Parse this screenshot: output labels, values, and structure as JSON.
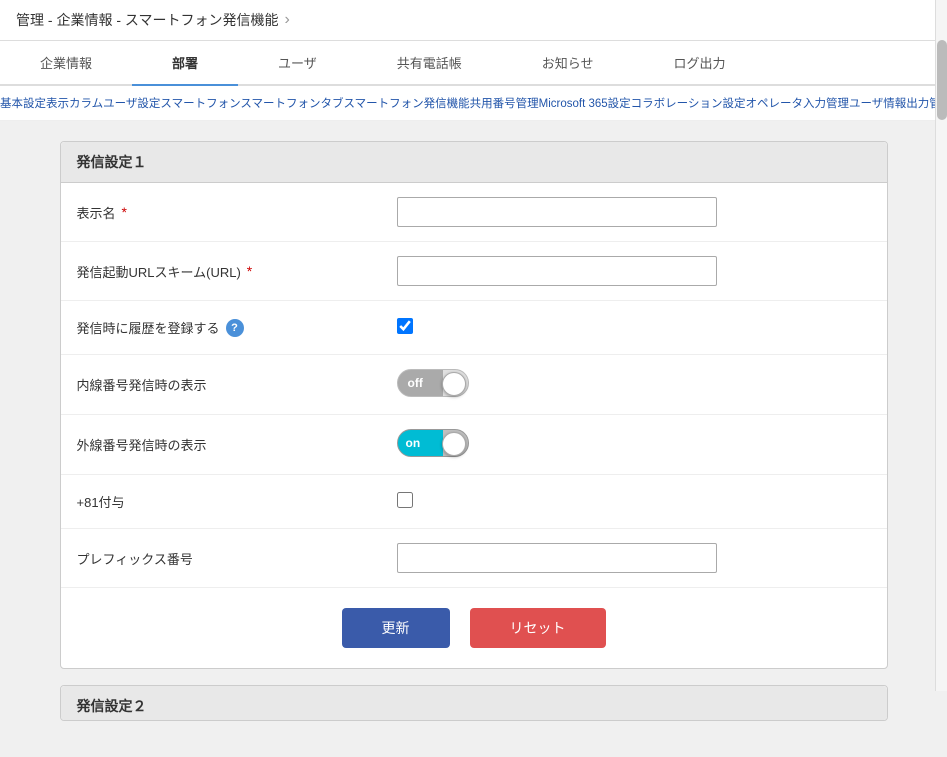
{
  "header": {
    "breadcrumb": "管理 - 企業情報 - スマートフォン発信機能",
    "arrow": "›"
  },
  "nav_tabs": [
    {
      "id": "company",
      "label": "企業情報",
      "active": false
    },
    {
      "id": "department",
      "label": "部署",
      "active": true
    },
    {
      "id": "user",
      "label": "ユーザ",
      "active": false
    },
    {
      "id": "shared_phonebook",
      "label": "共有電話帳",
      "active": false
    },
    {
      "id": "notice",
      "label": "お知らせ",
      "active": false
    },
    {
      "id": "log_output",
      "label": "ログ出力",
      "active": false
    }
  ],
  "sub_nav": "基本設定表示カラムユーザ設定スマートフォンスマートフォンタブスマートフォン発信機能共用番号管理Microsoft 365設定コラボレーション設定オペレータ入力管理ユーザ情報出力管理エクス",
  "section1": {
    "title": "発信設定１",
    "fields": [
      {
        "id": "display_name",
        "label": "表示名",
        "required": true,
        "type": "text",
        "value": ""
      },
      {
        "id": "url_scheme",
        "label": "発信起動URLスキーム(URL)",
        "required": true,
        "type": "text",
        "value": ""
      },
      {
        "id": "register_history",
        "label": "発信時に履歴を登録する",
        "required": false,
        "type": "checkbox",
        "checked": true,
        "help": true
      },
      {
        "id": "extension_display",
        "label": "内線番号発信時の表示",
        "required": false,
        "type": "toggle",
        "value": "off"
      },
      {
        "id": "external_display",
        "label": "外線番号発信時の表示",
        "required": false,
        "type": "toggle",
        "value": "on"
      },
      {
        "id": "plus81",
        "label": "+81付与",
        "required": false,
        "type": "checkbox",
        "checked": false
      },
      {
        "id": "prefix",
        "label": "プレフィックス番号",
        "required": false,
        "type": "text",
        "value": ""
      }
    ],
    "buttons": {
      "update": "更新",
      "reset": "リセット"
    }
  },
  "section2": {
    "title": "発信設定２"
  },
  "toggle_off_label": "off",
  "toggle_on_label": "on"
}
